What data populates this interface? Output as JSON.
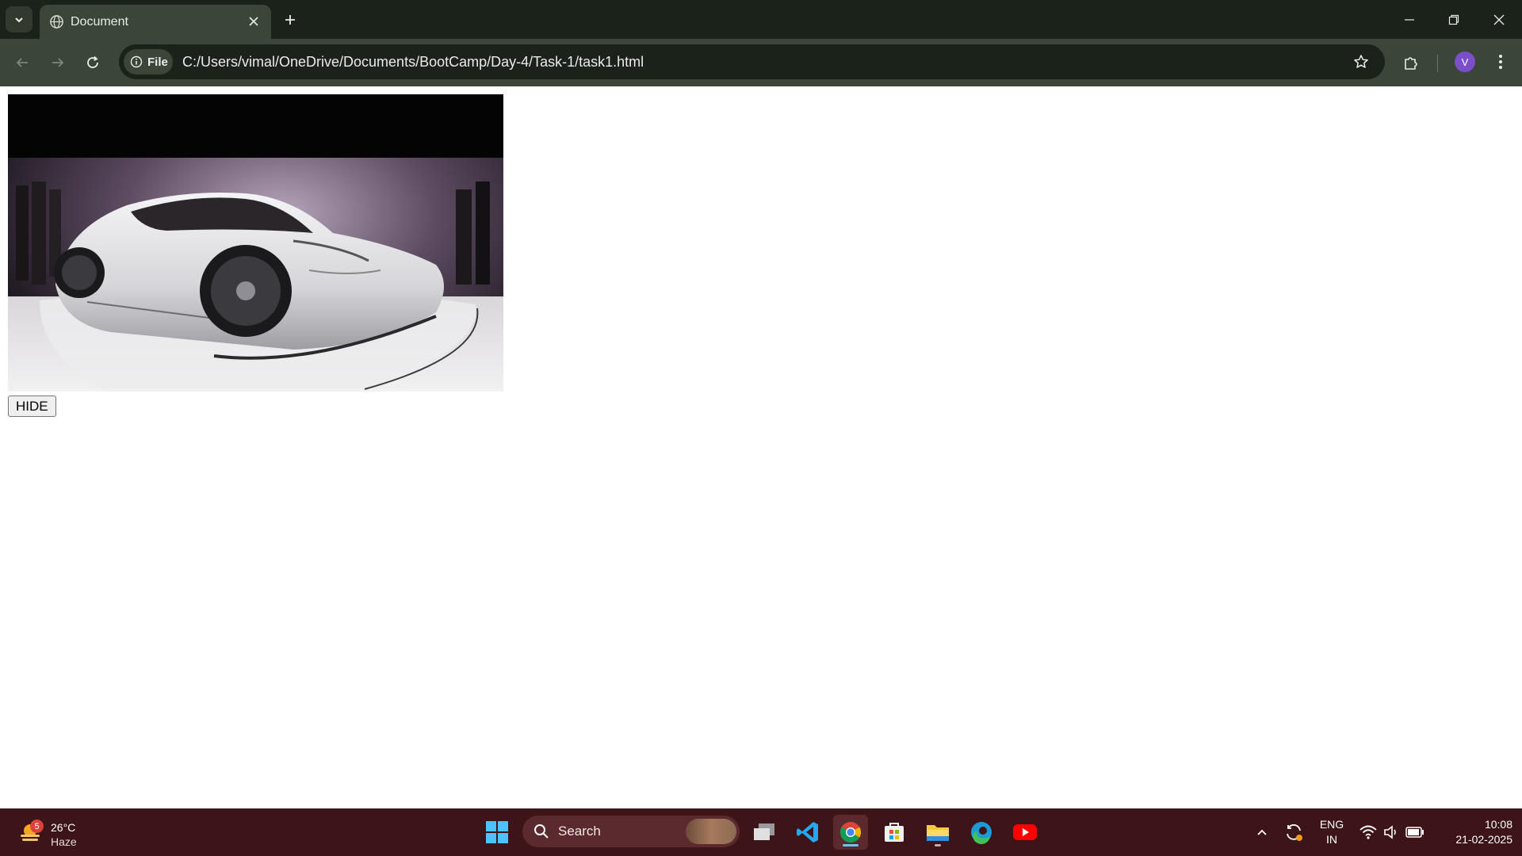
{
  "browser": {
    "tab_title": "Document",
    "address_chip": "File",
    "url": "C:/Users/vimal/OneDrive/Documents/BootCamp/Day-4/Task-1/task1.html",
    "profile_initial": "V",
    "icons": {
      "tab_search": "chevron-down-icon",
      "tab_favicon": "globe-icon",
      "tab_close": "close-icon",
      "new_tab": "plus-icon",
      "back": "arrow-left-icon",
      "forward": "arrow-right-icon",
      "reload": "reload-icon",
      "site_info": "info-icon",
      "bookmark": "star-icon",
      "extensions": "puzzle-icon",
      "menu": "kebab-menu-icon",
      "minimize": "minimize-icon",
      "restore": "restore-icon",
      "window_close": "close-icon"
    },
    "colors": {
      "frame": "#1a2219",
      "toolbar": "#3b4538",
      "avatar": "#7b4fc9"
    }
  },
  "page": {
    "image_alt": "white sports car",
    "hide_button_label": "HIDE"
  },
  "taskbar": {
    "weather_temp": "26°C",
    "weather_condition": "Haze",
    "weather_badge": "5",
    "search_label": "Search",
    "lang_primary": "ENG",
    "lang_secondary": "IN",
    "time": "10:08",
    "date": "21-02-2025",
    "pinned": [
      "start-icon",
      "search-icon",
      "task-view-icon",
      "vscode-icon",
      "chrome-icon",
      "microsoft-store-icon",
      "file-explorer-icon",
      "edge-icon",
      "youtube-icon"
    ],
    "tray": [
      "chevron-up-icon",
      "sync-icon",
      "wifi-icon",
      "volume-icon",
      "battery-icon"
    ],
    "colors": {
      "background": "#3d1418",
      "active_indicator": "#6cc3f2"
    }
  }
}
